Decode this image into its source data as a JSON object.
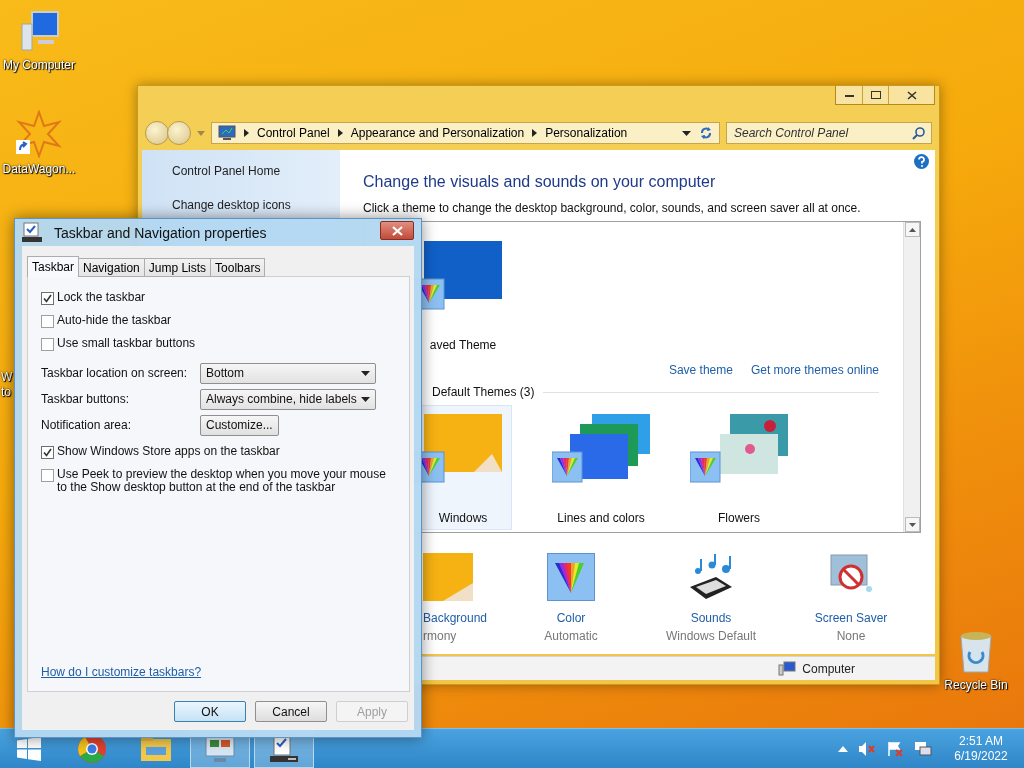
{
  "desktop_icons": [
    {
      "kind": "computer",
      "label": "My Computer"
    },
    {
      "kind": "app",
      "label": "DataWagon..."
    },
    {
      "kind": "hidden",
      "label": "W to"
    }
  ],
  "recycle_bin": {
    "label": "Recycle Bin"
  },
  "control_panel": {
    "breadcrumb": [
      "Control Panel",
      "Appearance and Personalization",
      "Personalization"
    ],
    "search": {
      "placeholder": "Search Control Panel"
    },
    "sidebar": [
      "Control Panel Home",
      "Change desktop icons"
    ],
    "heading": "Change the visuals and sounds on your computer",
    "description": "Click a theme to change the desktop background, color, sounds, and screen saver all at once.",
    "my_themes": [
      {
        "kind": "blue",
        "label": "aved Theme",
        "selected": false
      }
    ],
    "links": [
      "Save theme",
      "Get more themes online"
    ],
    "group_header": "Default Themes (3)",
    "themes": [
      {
        "kind": "windows",
        "label": "Windows",
        "selected": true
      },
      {
        "kind": "lines",
        "label": "Lines and colors",
        "selected": false
      },
      {
        "kind": "flowers",
        "label": "Flowers",
        "selected": false
      }
    ],
    "settings": [
      {
        "kind": "background",
        "title": "Background",
        "value": "rmony"
      },
      {
        "kind": "color",
        "title": "Color",
        "value": "Automatic"
      },
      {
        "kind": "sounds",
        "title": "Sounds",
        "value": "Windows Default"
      },
      {
        "kind": "screensaver",
        "title": "Screen Saver",
        "value": "None"
      }
    ],
    "status_bar": "Computer"
  },
  "dialog": {
    "title": "Taskbar and Navigation properties",
    "tabs": [
      {
        "label": "Taskbar",
        "selected": true
      },
      {
        "label": "Navigation",
        "selected": false
      },
      {
        "label": "Jump Lists",
        "selected": false
      },
      {
        "label": "Toolbars",
        "selected": false
      }
    ],
    "options": [
      {
        "kind": "checkbox",
        "label": "Lock the taskbar",
        "checked": true
      },
      {
        "kind": "checkbox",
        "label": "Auto-hide the taskbar",
        "checked": false
      },
      {
        "kind": "checkbox",
        "label": "Use small taskbar buttons",
        "checked": false
      },
      {
        "kind": "select",
        "label": "Taskbar location on screen:",
        "value": "Bottom"
      },
      {
        "kind": "select",
        "label": "Taskbar buttons:",
        "value": "Always combine, hide labels"
      },
      {
        "kind": "button",
        "label": "Notification area:",
        "button": "Customize..."
      },
      {
        "kind": "checkbox",
        "label": "Show Windows Store apps on the taskbar",
        "checked": true
      },
      {
        "kind": "checkbox",
        "label": "Use Peek to preview the desktop when you move your mouse to the Show desktop button at the end of the taskbar",
        "checked": false
      }
    ],
    "help_link": "How do I customize taskbars?",
    "buttons": [
      {
        "label": "OK",
        "default": true,
        "disabled": false
      },
      {
        "label": "Cancel",
        "default": false,
        "disabled": false
      },
      {
        "label": "Apply",
        "default": false,
        "disabled": true
      }
    ]
  },
  "taskbar": {
    "apps": [
      {
        "kind": "chrome",
        "running": false
      },
      {
        "kind": "explorer",
        "running": false
      },
      {
        "kind": "control-panel",
        "running": true
      },
      {
        "kind": "taskbar-properties",
        "running": true
      }
    ],
    "time": "2:51 AM",
    "date": "6/19/2022"
  }
}
